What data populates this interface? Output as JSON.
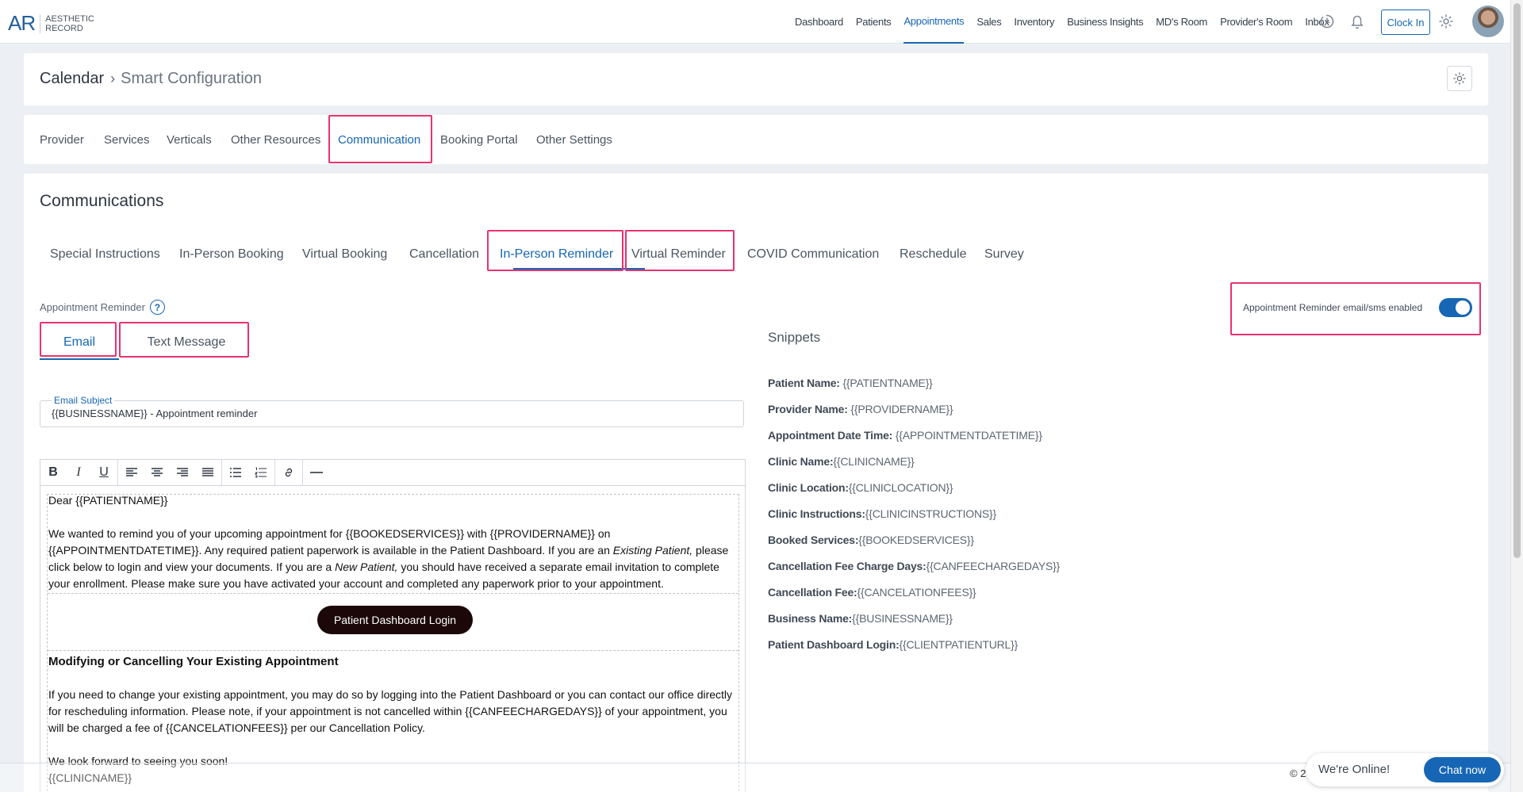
{
  "brand": {
    "mark": "AR",
    "line1": "AESTHETIC",
    "line2": "RECORD"
  },
  "nav": {
    "items": [
      "Dashboard",
      "Patients",
      "Appointments",
      "Sales",
      "Inventory",
      "Business Insights",
      "MD's Room",
      "Provider's Room",
      "Inbox"
    ],
    "active": "Appointments",
    "clock_in": "Clock In"
  },
  "breadcrumb": {
    "main": "Calendar",
    "sub": "Smart Configuration"
  },
  "config_tabs": {
    "items": [
      "Provider",
      "Services",
      "Verticals",
      "Other Resources",
      "Communication",
      "Booking Portal",
      "Other Settings"
    ],
    "active": "Communication"
  },
  "communications": {
    "title": "Communications",
    "tabs": [
      "Special Instructions",
      "In-Person Booking",
      "Virtual Booking",
      "Cancellation",
      "In-Person Reminder",
      "Virtual Reminder",
      "COVID Communication",
      "Reschedule",
      "Survey"
    ],
    "active": "In-Person Reminder",
    "reminder_label": "Appointment Reminder",
    "toggle_label": "Appointment Reminder email/sms enabled",
    "toggle_on": true,
    "subtabs": [
      "Email",
      "Text Message"
    ],
    "subtab_active": "Email",
    "email_subject_label": "Email Subject",
    "email_subject_value": "{{BUSINESSNAME}} - Appointment reminder"
  },
  "editor": {
    "greeting": "Dear {{PATIENTNAME}}",
    "p1_a": "We wanted to remind you of your upcoming appointment for {{BOOKEDSERVICES}} with {{PROVIDERNAME}} on {{APPOINTMENTDATETIME}}. Any required patient paperwork is available in the Patient Dashboard.  If you are an ",
    "p1_em1": "Existing Patient,",
    "p1_b": " please click below to login and view your documents. If you are a ",
    "p1_em2": "New Patient,",
    "p1_c": " you should have received a separate email invitation to complete your enrollment. Please make sure you have activated your account and completed any paperwork prior to your appointment.",
    "button": "Patient Dashboard Login",
    "heading": "Modifying or Cancelling Your Existing Appointment",
    "p2": "If you need to change your existing appointment, you may do so by logging into the Patient Dashboard or you can contact our office directly for rescheduling information.  Please note, if your appointment is not cancelled within {{CANFEECHARGEDAYS}} of your appointment, you will be charged a fee of {{CANCELATIONFEES}} per our Cancellation Policy.",
    "closing": "We look forward to seeing you soon!",
    "signature": "{{CLINICNAME}}"
  },
  "snippets": {
    "title": "Snippets",
    "items": [
      {
        "name": "Patient Name:",
        "token": " {{PATIENTNAME}}"
      },
      {
        "name": "Provider Name:",
        "token": " {{PROVIDERNAME}}"
      },
      {
        "name": "Appointment Date Time:",
        "token": " {{APPOINTMENTDATETIME}}"
      },
      {
        "name": "Clinic Name:",
        "token": "{{CLINICNAME}}"
      },
      {
        "name": "Clinic Location:",
        "token": "{{CLINICLOCATION}}"
      },
      {
        "name": "Clinic Instructions:",
        "token": "{{CLINICINSTRUCTIONS}}"
      },
      {
        "name": "Booked Services:",
        "token": "{{BOOKEDSERVICES}}"
      },
      {
        "name": "Cancellation Fee Charge Days:",
        "token": "{{CANFEECHARGEDAYS}}"
      },
      {
        "name": "Cancellation Fee:",
        "token": "{{CANCELATIONFEES}}"
      },
      {
        "name": "Business Name:",
        "token": "{{BUSINESSNAME}}"
      },
      {
        "name": "Patient Dashboard Login:",
        "token": "{{CLIENTPATIENTURL}}"
      }
    ]
  },
  "footer": {
    "copyright": "© 2"
  },
  "chat": {
    "status": "We're Online!",
    "button": "Chat now"
  },
  "colors": {
    "accent": "#1666b5",
    "highlight": "#e8336d",
    "button_dark": "#1c0808"
  }
}
